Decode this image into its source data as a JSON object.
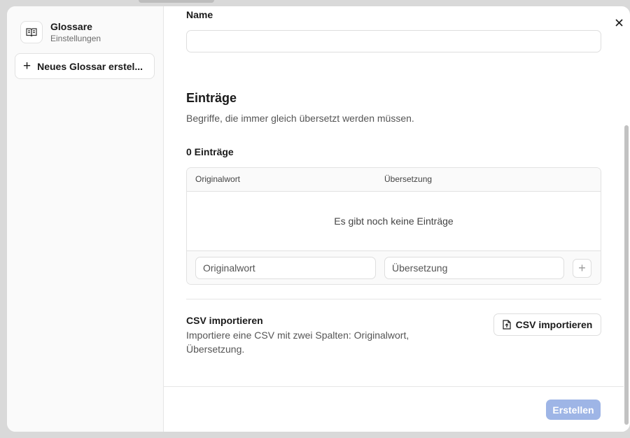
{
  "sidebar": {
    "title": "Glossare",
    "subtitle": "Einstellungen",
    "new_button_label": "Neues Glossar erstel..."
  },
  "form": {
    "name_label": "Name",
    "name_value": ""
  },
  "entries": {
    "heading": "Einträge",
    "description": "Begriffe, die immer gleich übersetzt werden müssen.",
    "count_label": "0 Einträge",
    "columns": [
      "Originalwort",
      "Übersetzung"
    ],
    "empty_message": "Es gibt noch keine Einträge",
    "original_placeholder": "Originalwort",
    "translation_placeholder": "Übersetzung"
  },
  "csv": {
    "title": "CSV importieren",
    "description": "Importiere eine CSV mit zwei Spalten: Originalwort, Übersetzung.",
    "button_label": "CSV importieren"
  },
  "footer": {
    "create_label": "Erstellen"
  },
  "colors": {
    "primary_disabled": "#9eb5e6",
    "sidebar_bg": "#fafafa",
    "border": "#e2e2e2"
  },
  "icons": [
    "book-open-icon",
    "plus-icon",
    "close-icon",
    "file-upload-icon"
  ]
}
